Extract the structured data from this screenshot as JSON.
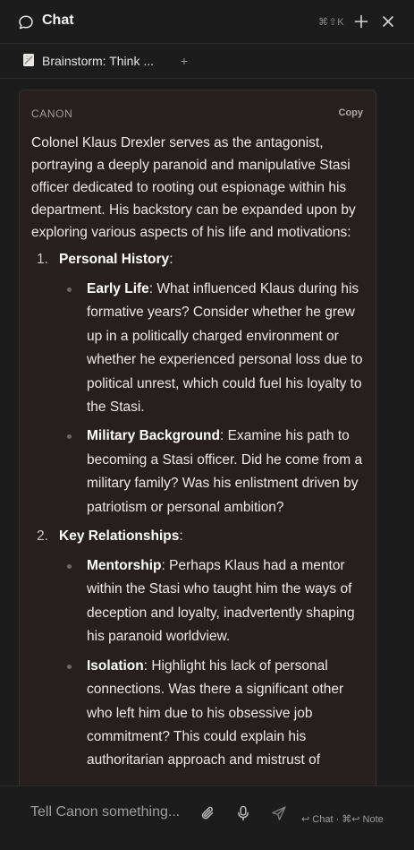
{
  "header": {
    "title": "Chat",
    "shortcut": "⌘⇧K"
  },
  "tab": {
    "label": "Brainstorm: Think ...",
    "add_label": "+"
  },
  "message": {
    "sender": "CANON",
    "copy_label": "Copy",
    "intro": "Colonel Klaus Drexler serves as the antagonist, portraying a deeply paranoid and manipulative Stasi officer dedicated to rooting out espionage within his department. His backstory can be expanded upon by exploring various aspects of his life and motivations:",
    "sections": [
      {
        "number": "1.",
        "title": "Personal History",
        "colon": ":",
        "items": [
          {
            "term": "Early Life",
            "text": ": What influenced Klaus during his formative years? Consider whether he grew up in a politically charged environment or whether he experienced personal loss due to political unrest, which could fuel his loyalty to the Stasi."
          },
          {
            "term": "Military Background",
            "text": ": Examine his path to becoming a Stasi officer. Did he come from a military family? Was his enlistment driven by patriotism or personal ambition?"
          }
        ]
      },
      {
        "number": "2.",
        "title": "Key Relationships",
        "colon": ":",
        "items": [
          {
            "term": "Mentorship",
            "text": ": Perhaps Klaus had a mentor within the Stasi who taught him the ways of deception and loyalty, inadvertently shaping his paranoid worldview."
          },
          {
            "term": "Isolation",
            "text": ": Highlight his lack of personal connections. Was there a significant other who left him due to his obsessive job commitment? This could explain his authoritarian approach and mistrust of"
          }
        ]
      }
    ]
  },
  "input": {
    "placeholder": "Tell Canon something...",
    "hint": "↩ Chat · ⌘↩ Note"
  },
  "icons": {
    "chat": "chat-bubble-icon",
    "new": "plus-icon",
    "close": "close-icon",
    "tab": "note-icon",
    "attach": "paperclip-icon",
    "mic": "microphone-icon",
    "send": "send-icon"
  }
}
